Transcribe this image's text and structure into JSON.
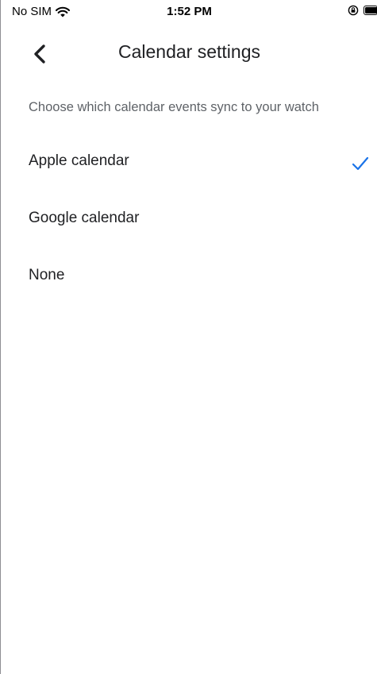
{
  "status_bar": {
    "carrier": "No SIM",
    "time": "1:52 PM",
    "icons": [
      "wifi-icon",
      "rotation-lock-icon",
      "battery-icon"
    ]
  },
  "header": {
    "back_icon": "chevron-left-icon",
    "title": "Calendar settings"
  },
  "subtitle": "Choose which calendar events sync to your watch",
  "options": [
    {
      "label": "Apple calendar",
      "selected": true
    },
    {
      "label": "Google calendar",
      "selected": false
    },
    {
      "label": "None",
      "selected": false
    }
  ],
  "colors": {
    "accent": "#1a73e8",
    "text_primary": "#202124",
    "text_secondary": "#5f6368"
  }
}
